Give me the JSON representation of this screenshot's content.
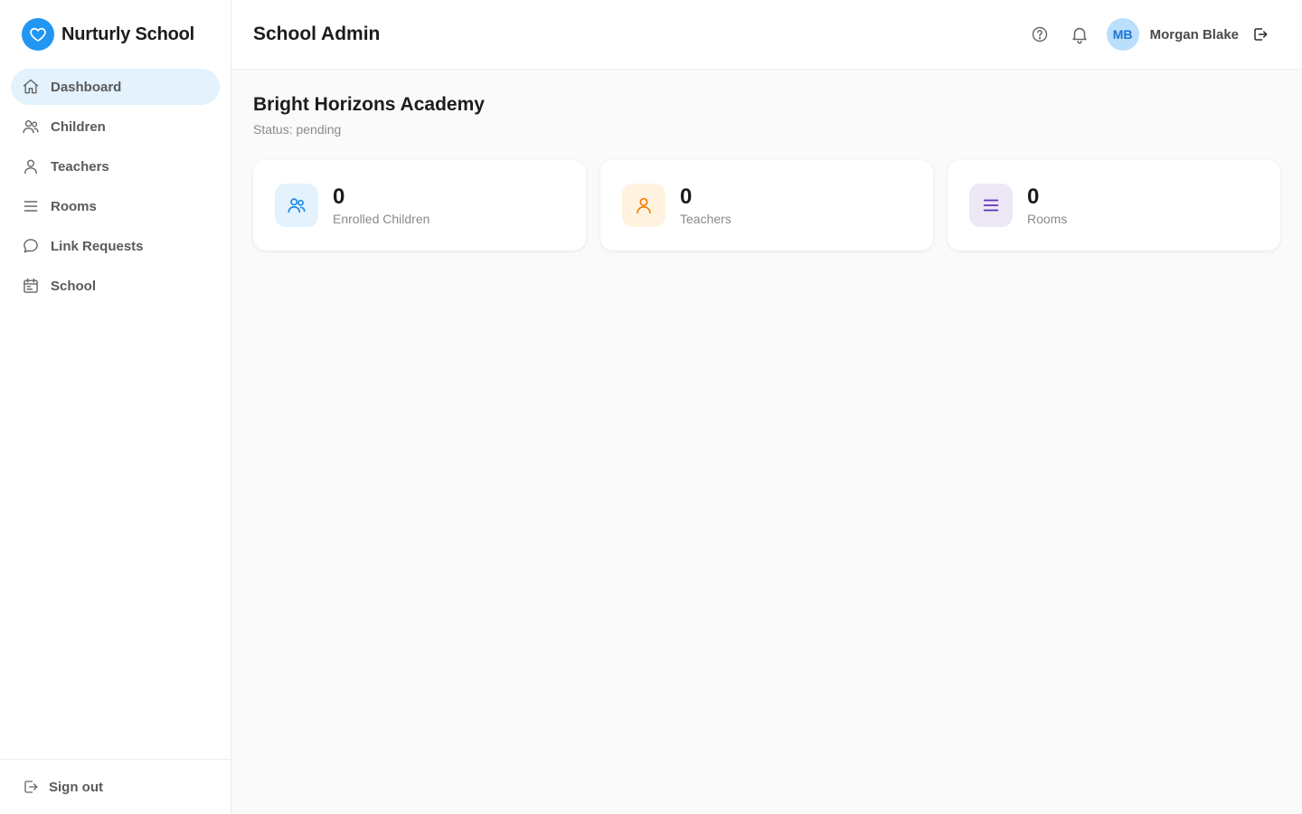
{
  "brand": {
    "name": "Nurturly School",
    "logo_icon": "heart-icon",
    "color": "#2196f3"
  },
  "sidebar": {
    "items": [
      {
        "label": "Dashboard",
        "icon": "home-icon",
        "active": true
      },
      {
        "label": "Children",
        "icon": "users-icon",
        "active": false
      },
      {
        "label": "Teachers",
        "icon": "user-icon",
        "active": false
      },
      {
        "label": "Rooms",
        "icon": "menu-icon",
        "active": false
      },
      {
        "label": "Link Requests",
        "icon": "message-icon",
        "active": false
      },
      {
        "label": "School",
        "icon": "calendar-icon",
        "active": false
      }
    ],
    "footer": {
      "label": "Sign out",
      "icon": "logout-icon"
    },
    "active_bg": "#e3f2fd"
  },
  "header": {
    "title": "School Admin",
    "icons": [
      "help-icon",
      "bell-icon",
      "logout-icon"
    ],
    "user": {
      "initials": "MB",
      "name": "Morgan Blake",
      "avatar_bg": "#bbdefb",
      "avatar_color": "#1976d2"
    }
  },
  "main": {
    "school_name": "Bright Horizons Academy",
    "status": "Status: pending",
    "stats": [
      {
        "value": "0",
        "label": "Enrolled Children",
        "icon": "users-icon",
        "icon_bg": "#e3f2fd",
        "icon_color": "#1e88e5"
      },
      {
        "value": "0",
        "label": "Teachers",
        "icon": "user-icon",
        "icon_bg": "#fff3e0",
        "icon_color": "#f57c00"
      },
      {
        "value": "0",
        "label": "Rooms",
        "icon": "menu-icon",
        "icon_bg": "#ede7f6",
        "icon_color": "#5e35b1"
      }
    ]
  }
}
